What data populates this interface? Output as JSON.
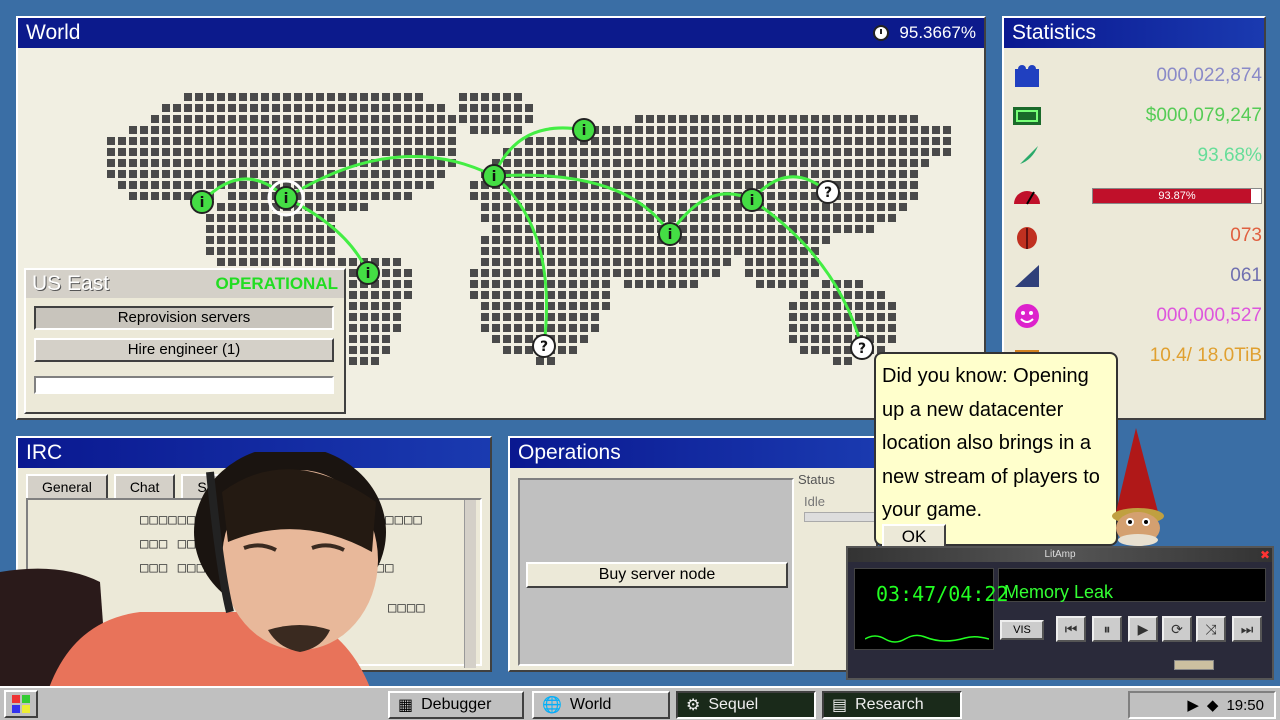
{
  "world": {
    "title": "World",
    "uptime": "95.3667%"
  },
  "region": {
    "name": "US East",
    "status": "OPERATIONAL",
    "buttons": [
      "Reprovision servers",
      "Hire engineer (1)"
    ]
  },
  "statistics": {
    "title": "Statistics",
    "rows": [
      {
        "icon": "players-icon",
        "value": "000,022,874",
        "color": "#8a8ac8"
      },
      {
        "icon": "money-icon",
        "value": "$000,079,247",
        "color": "#55cc55"
      },
      {
        "icon": "feather-icon",
        "value": "93.68%",
        "color": "#66dd99"
      },
      {
        "icon": "gauge-icon",
        "value": "93.87%",
        "fill": 0.9387
      },
      {
        "icon": "bug-icon",
        "value": "073",
        "color": "#e06040"
      },
      {
        "icon": "signal-icon",
        "value": "061",
        "color": "#7070b0"
      },
      {
        "icon": "smiley-icon",
        "value": "000,000,527",
        "color": "#dd55dd"
      },
      {
        "icon": "storage-icon",
        "value": "10.4/ 18.0TiB",
        "color": "#e0a030"
      }
    ]
  },
  "irc": {
    "title": "IRC",
    "tabs": [
      "General",
      "Chat",
      "Su"
    ]
  },
  "operations": {
    "title": "Operations",
    "buy_label": "Buy server node",
    "status_label": "Status",
    "status_value": "Idle"
  },
  "tip": {
    "text": "Did you know: Opening up a new datacenter location also brings in a new stream of players to your game.",
    "ok": "OK"
  },
  "player": {
    "title": "LitAmp",
    "time": "03:47/04:22",
    "track": "Memory Leak",
    "vis": "VIS"
  },
  "taskbar": {
    "tasks": [
      "Debugger",
      "World",
      "Sequel",
      "Research"
    ],
    "clock": "19:50"
  },
  "colors": {
    "titlebar": "#0c1a8c",
    "operational": "#22dd22",
    "node": "#44dd44",
    "link": "#44ee44"
  }
}
